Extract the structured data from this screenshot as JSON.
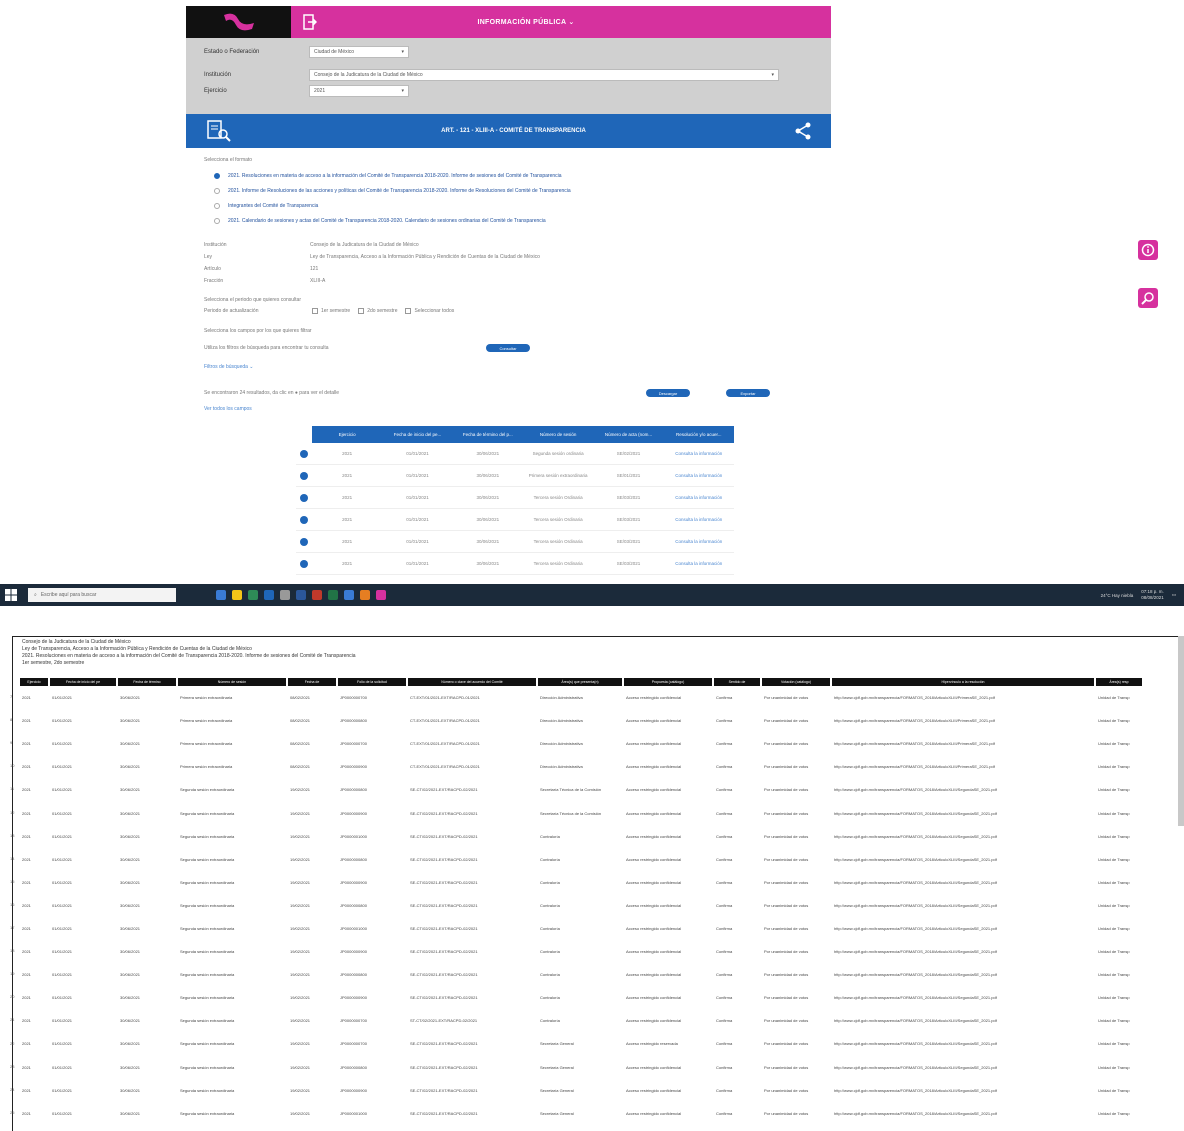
{
  "header": {
    "title": "INFORMACIÓN PÚBLICA",
    "title_caret": "⌄"
  },
  "filters": [
    {
      "label": "Estado o Federación",
      "value": "Ciudad de México",
      "width": 100
    },
    {
      "label": "Institución",
      "value": "Consejo de la Judicatura de la Ciudad de México",
      "width": 470
    },
    {
      "label": "Ejercicio",
      "value": "2021",
      "width": 100
    }
  ],
  "banner": {
    "title": "ART. - 121 - XLIII-A - COMITÉ DE TRANSPARENCIA"
  },
  "format": {
    "heading": "Selecciona el formato",
    "options": [
      {
        "label": "2021. Resoluciones en materia de acceso a la información del Comité de Transparencia 2018-2020. Informe de sesiones del Comité de Transparencia",
        "selected": true
      },
      {
        "label": "2021. Informe de Resoluciones de las acciones y políticas del Comité de Transparencia 2018-2020. Informe de Resoluciones del Comité de Transparencia",
        "selected": false
      },
      {
        "label": "Integrantes del Comité de Transparencia",
        "selected": false
      },
      {
        "label": "2021. Calendario de sesiones y actas del Comité de Transparencia 2018-2020. Calendario de sesiones ordinarias del Comité de Transparencia",
        "selected": false
      }
    ]
  },
  "details": [
    {
      "k": "Institución",
      "v": "Consejo de la Judicatura de la Ciudad de México"
    },
    {
      "k": "Ley",
      "v": "Ley de Transparencia, Acceso a la Información Pública y Rendición de Cuentas de la Ciudad de México"
    },
    {
      "k": "Artículo",
      "v": "121"
    },
    {
      "k": "Fracción",
      "v": "XLIII-A"
    }
  ],
  "period": {
    "heading": "Selecciona el periodo que quieres consultar",
    "label": "Periodo de actualización",
    "options": [
      "1er semestre",
      "2do semestre",
      "Seleccionar todos"
    ]
  },
  "filters_note": "Selecciona los campos por los que quieres filtrar",
  "consult_line": {
    "text": "Utiliza los filtros de búsqueda para encontrar tu consulta",
    "button": "Consultar"
  },
  "more_filters": "Filtros de búsqueda ⌄",
  "results_line": "Se encontraron 24 resultados, da clic en ● para ver el detalle",
  "select_fields": "Ver todos los campos",
  "pills": {
    "download": "Descargar",
    "export": "Exportar"
  },
  "results": {
    "headers": [
      "Ejercicio",
      "Fecha de inicio del pe...",
      "Fecha de término del p...",
      "Número de sesión",
      "Número de acta (nom...",
      "Resolución y/o acuer..."
    ],
    "rows": [
      [
        "2021",
        "01/01/2021",
        "30/06/2021",
        "Segunda sesión ordinaria",
        "SE/02/2021",
        "Consulta la información"
      ],
      [
        "2021",
        "01/01/2021",
        "30/06/2021",
        "Primera sesión extraordinaria",
        "SE/01/2021",
        "Consulta la información"
      ],
      [
        "2021",
        "01/01/2021",
        "30/06/2021",
        "Tercera sesión Ordinaria",
        "SE/03/2021",
        "Consulta la información"
      ],
      [
        "2021",
        "01/01/2021",
        "30/06/2021",
        "Tercera sesión Ordinaria",
        "SE/03/2021",
        "Consulta la información"
      ],
      [
        "2021",
        "01/01/2021",
        "30/06/2021",
        "Tercera sesión Ordinaria",
        "SE/03/2021",
        "Consulta la información"
      ],
      [
        "2021",
        "01/01/2021",
        "30/06/2021",
        "Tercera sesión Ordinaria",
        "SE/03/2021",
        "Consulta la información"
      ]
    ]
  },
  "taskbar": {
    "search_placeholder": "Escribe aquí para buscar",
    "tray_status": "24°C Hay niebla",
    "time": "07:18 p. m.",
    "date": "08/08/2021",
    "app_colors": [
      "#3a7bd5",
      "#f5c518",
      "#2e8b57",
      "#1f66b8",
      "#999999",
      "#2b579a",
      "#c0392b",
      "#217346",
      "#3a7bd5",
      "#e67e22",
      "#d6319e"
    ]
  },
  "sheet": {
    "meta": [
      "Consejo de la Judicatura de la Ciudad de México",
      "Ley de Transparencia, Acceso a la Información Pública y Rendición de Cuentas de la Ciudad de México",
      "2021. Resoluciones en materia de acceso a la información del Comité de Transparencia 2018-2020. Informe de sesiones del Comité de Transparencia",
      "1er semestre, 2do semestre"
    ],
    "headers": [
      "Ejercicio",
      "Fecha de inicio del pe",
      "Fecha de término",
      "Número de sesión",
      "Fecha de",
      "Folio de la solicitud",
      "Número o clave del acuerdo del Comité",
      "Área(s) que presenta(n)",
      "Propuesta (catálogo)",
      "Sentido de",
      "Votación (catálogo)",
      "Hipervínculo a la resolución",
      "Área(s) resp"
    ],
    "col_widths": [
      28,
      66,
      58,
      108,
      48,
      68,
      128,
      84,
      88,
      46,
      68,
      262,
      46
    ],
    "rows": [
      [
        "2021",
        "01/01/2021",
        "30/06/2021",
        "Primera sesión extraordinaria",
        "08/02/2021",
        "JP0000000700",
        "CT-EXT/01/2021-EXT/RACPD-01/2021",
        "Dirección Administrativa",
        "Acceso restringido confidencial",
        "Confirma",
        "Por unanimidad de votos",
        "http://www.cjdf.gob.mx/transparencia/FORMATOS_2018/ArticuloXLIII/PrimeraSE_2021.pdf",
        "Unidad de Transp"
      ],
      [
        "2021",
        "01/01/2021",
        "30/06/2021",
        "Primera sesión extraordinaria",
        "08/02/2021",
        "JP0000000800",
        "CT-EXT/01/2021-EXT/RACPD-01/2021",
        "Dirección Administrativa",
        "Acceso restringido confidencial",
        "Confirma",
        "Por unanimidad de votos",
        "http://www.cjdf.gob.mx/transparencia/FORMATOS_2018/ArticuloXLIII/PrimeraSE_2021.pdf",
        "Unidad de Transp"
      ],
      [
        "2021",
        "01/01/2021",
        "30/06/2021",
        "Primera sesión extraordinaria",
        "08/02/2021",
        "JP0000000700",
        "CT-EXT/01/2021-EXT/RACPD-01/2021",
        "Dirección Administrativa",
        "Acceso restringido confidencial",
        "Confirma",
        "Por unanimidad de votos",
        "http://www.cjdf.gob.mx/transparencia/FORMATOS_2018/ArticuloXLIII/PrimeraSE_2021.pdf",
        "Unidad de Transp"
      ],
      [
        "2021",
        "01/01/2021",
        "30/06/2021",
        "Primera sesión extraordinaria",
        "08/02/2021",
        "JP0000000900",
        "CT-EXT/01/2021-EXT/RACPD-01/2021",
        "Dirección Administrativa",
        "Acceso restringido confidencial",
        "Confirma",
        "Por unanimidad de votos",
        "http://www.cjdf.gob.mx/transparencia/FORMATOS_2018/ArticuloXLIII/PrimeraSE_2021.pdf",
        "Unidad de Transp"
      ],
      [
        "2021",
        "01/01/2021",
        "30/06/2021",
        "Segunda sesión extraordinaria",
        "19/02/2021",
        "JP0000000800",
        "SE-CT/02/2021-EXT/RACPD-02/2021",
        "Secretaría Técnica de la Comisión",
        "Acceso restringido confidencial",
        "Confirma",
        "Por unanimidad de votos",
        "http://www.cjdf.gob.mx/transparencia/FORMATOS_2018/ArticuloXLIII/SegundaSE_2021.pdf",
        "Unidad de Transp"
      ],
      [
        "2021",
        "01/01/2021",
        "30/06/2021",
        "Segunda sesión extraordinaria",
        "19/02/2021",
        "JP0000000900",
        "SE-CT/02/2021-EXT/RACPD-02/2021",
        "Secretaría Técnica de la Comisión",
        "Acceso restringido confidencial",
        "Confirma",
        "Por unanimidad de votos",
        "http://www.cjdf.gob.mx/transparencia/FORMATOS_2018/ArticuloXLIII/SegundaSE_2021.pdf",
        "Unidad de Transp"
      ],
      [
        "2021",
        "01/01/2021",
        "30/06/2021",
        "Segunda sesión extraordinaria",
        "19/02/2021",
        "JP0000001000",
        "SE-CT/02/2021-EXT/RACPD-02/2021",
        "Contraloría",
        "Acceso restringido confidencial",
        "Confirma",
        "Por unanimidad de votos",
        "http://www.cjdf.gob.mx/transparencia/FORMATOS_2018/ArticuloXLIII/SegundaSE_2021.pdf",
        "Unidad de Transp"
      ],
      [
        "2021",
        "01/01/2021",
        "30/06/2021",
        "Segunda sesión extraordinaria",
        "19/02/2021",
        "JP0000000800",
        "SE-CT/02/2021-EXT/RACPD-02/2021",
        "Contraloría",
        "Acceso restringido confidencial",
        "Confirma",
        "Por unanimidad de votos",
        "http://www.cjdf.gob.mx/transparencia/FORMATOS_2018/ArticuloXLIII/SegundaSE_2021.pdf",
        "Unidad de Transp"
      ],
      [
        "2021",
        "01/01/2021",
        "30/06/2021",
        "Segunda sesión extraordinaria",
        "19/02/2021",
        "JP0000000900",
        "SE-CT/02/2021-EXT/RACPD-02/2021",
        "Contraloría",
        "Acceso restringido confidencial",
        "Confirma",
        "Por unanimidad de votos",
        "http://www.cjdf.gob.mx/transparencia/FORMATOS_2018/ArticuloXLIII/SegundaSE_2021.pdf",
        "Unidad de Transp"
      ],
      [
        "2021",
        "01/01/2021",
        "30/06/2021",
        "Segunda sesión extraordinaria",
        "19/02/2021",
        "JP0000000800",
        "SE-CT/02/2021-EXT/RACPD-02/2021",
        "Contraloría",
        "Acceso restringido confidencial",
        "Confirma",
        "Por unanimidad de votos",
        "http://www.cjdf.gob.mx/transparencia/FORMATOS_2018/ArticuloXLIII/SegundaSE_2021.pdf",
        "Unidad de Transp"
      ],
      [
        "2021",
        "01/01/2021",
        "30/06/2021",
        "Segunda sesión extraordinaria",
        "19/02/2021",
        "JP0000001000",
        "SE-CT/02/2021-EXT/RACPD-02/2021",
        "Contraloría",
        "Acceso restringido confidencial",
        "Confirma",
        "Por unanimidad de votos",
        "http://www.cjdf.gob.mx/transparencia/FORMATOS_2018/ArticuloXLIII/SegundaSE_2021.pdf",
        "Unidad de Transp"
      ],
      [
        "2021",
        "01/01/2021",
        "30/06/2021",
        "Segunda sesión extraordinaria",
        "19/02/2021",
        "JP0000000900",
        "SE-CT/02/2021-EXT/RACPD-02/2021",
        "Contraloría",
        "Acceso restringido confidencial",
        "Confirma",
        "Por unanimidad de votos",
        "http://www.cjdf.gob.mx/transparencia/FORMATOS_2018/ArticuloXLIII/SegundaSE_2021.pdf",
        "Unidad de Transp"
      ],
      [
        "2021",
        "01/01/2021",
        "30/06/2021",
        "Segunda sesión extraordinaria",
        "19/02/2021",
        "JP0000000800",
        "SE-CT/02/2021-EXT/RACPD-02/2021",
        "Contraloría",
        "Acceso restringido confidencial",
        "Confirma",
        "Por unanimidad de votos",
        "http://www.cjdf.gob.mx/transparencia/FORMATOS_2018/ArticuloXLIII/SegundaSE_2021.pdf",
        "Unidad de Transp"
      ],
      [
        "2021",
        "01/01/2021",
        "30/06/2021",
        "Segunda sesión extraordinaria",
        "19/02/2021",
        "JP0000000900",
        "SE-CT/02/2021-EXT/RACPD-02/2021",
        "Contraloría",
        "Acceso restringido confidencial",
        "Confirma",
        "Por unanimidad de votos",
        "http://www.cjdf.gob.mx/transparencia/FORMATOS_2018/ArticuloXLIII/SegundaSE_2021.pdf",
        "Unidad de Transp"
      ],
      [
        "2021",
        "01/01/2021",
        "30/06/2021",
        "Segunda sesión extraordinaria",
        "19/02/2021",
        "JP0000000700",
        "ST-CT/02/2021-EXT/RACPD-02/2021",
        "Contraloría",
        "Acceso restringido confidencial",
        "Confirma",
        "Por unanimidad de votos",
        "http://www.cjdf.gob.mx/transparencia/FORMATOS_2018/ArticuloXLIII/SegundaSE_2021.pdf",
        "Unidad de Transp"
      ],
      [
        "2021",
        "01/01/2021",
        "30/06/2021",
        "Segunda sesión extraordinaria",
        "19/02/2021",
        "JP0000000700",
        "SE-CT/02/2021-EXT/RACPD-02/2021",
        "Secretaría General",
        "Acceso restringido reservada",
        "Confirma",
        "Por unanimidad de votos",
        "http://www.cjdf.gob.mx/transparencia/FORMATOS_2018/ArticuloXLIII/SegundaSE_2021.pdf",
        "Unidad de Transp"
      ],
      [
        "2021",
        "01/01/2021",
        "30/06/2021",
        "Segunda sesión extraordinaria",
        "19/02/2021",
        "JP0000000800",
        "SE-CT/02/2021-EXT/RACPD-02/2021",
        "Secretaría General",
        "Acceso restringido confidencial",
        "Confirma",
        "Por unanimidad de votos",
        "http://www.cjdf.gob.mx/transparencia/FORMATOS_2018/ArticuloXLIII/SegundaSE_2021.pdf",
        "Unidad de Transp"
      ],
      [
        "2021",
        "01/01/2021",
        "30/06/2021",
        "Segunda sesión extraordinaria",
        "19/02/2021",
        "JP0000000900",
        "SE-CT/02/2021-EXT/RACPD-02/2021",
        "Secretaría General",
        "Acceso restringido confidencial",
        "Confirma",
        "Por unanimidad de votos",
        "http://www.cjdf.gob.mx/transparencia/FORMATOS_2018/ArticuloXLIII/SegundaSE_2021.pdf",
        "Unidad de Transp"
      ],
      [
        "2021",
        "01/01/2021",
        "30/06/2021",
        "Segunda sesión extraordinaria",
        "19/02/2021",
        "JP0000001000",
        "SE-CT/02/2021-EXT/RACPD-02/2021",
        "Secretaría General",
        "Acceso restringido confidencial",
        "Confirma",
        "Por unanimidad de votos",
        "http://www.cjdf.gob.mx/transparencia/FORMATOS_2018/ArticuloXLIII/SegundaSE_2021.pdf",
        "Unidad de Transp"
      ]
    ],
    "row_numbers": [
      "7",
      "8",
      "9",
      "10",
      "11",
      "12",
      "13",
      "14",
      "15",
      "16",
      "17",
      "18",
      "19",
      "20",
      "21",
      "22",
      "23",
      "24",
      "25"
    ]
  },
  "colors": {
    "magenta": "#d6319e",
    "blue": "#1f66b8",
    "gray": "#d0d0d0",
    "taskbar": "#1b2a3a"
  }
}
